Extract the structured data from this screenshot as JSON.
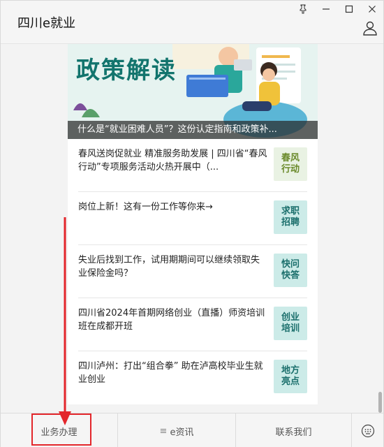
{
  "app": {
    "title": "四川e就业"
  },
  "window_controls": [
    "pin-icon",
    "minimize-icon",
    "maximize-icon",
    "close-icon"
  ],
  "banner": {
    "title": "政策解读",
    "caption": "什么是“就业困难人员”？这份认定指南和政策补..."
  },
  "news": [
    {
      "text": "春风送岗促就业 精准服务助发展 | 四川省“春风行动”专项服务活动火热开展中（...",
      "thumb": "春风行动",
      "thumb_bg": "#e9f2e3",
      "thumb_fg": "#6a8a2a"
    },
    {
      "text": "岗位上新！这有一份工作等你来→",
      "thumb": "求职招聘",
      "thumb_bg": "#ccebe8",
      "thumb_fg": "#1b6f6c"
    },
    {
      "text": "失业后找到工作，试用期期间可以继续领取失业保险金吗？",
      "thumb": "快问快答",
      "thumb_bg": "#ccebe8",
      "thumb_fg": "#1b6f6c"
    },
    {
      "text": "四川省2024年首期网络创业（直播）师资培训班在成都开班",
      "thumb": "创业培训",
      "thumb_bg": "#ccebe8",
      "thumb_fg": "#1b6f6c"
    },
    {
      "text": "四川泸州：打出“组合拳” 助在泸高校毕业生就业创业",
      "thumb": "地方亮点",
      "thumb_bg": "#ccebe8",
      "thumb_fg": "#1b6f6c"
    }
  ],
  "tabs": {
    "business": "业务办理",
    "news": "e资讯",
    "contact": "联系我们"
  },
  "colors": {
    "accent": "#12746d",
    "highlight": "#e3262b"
  }
}
